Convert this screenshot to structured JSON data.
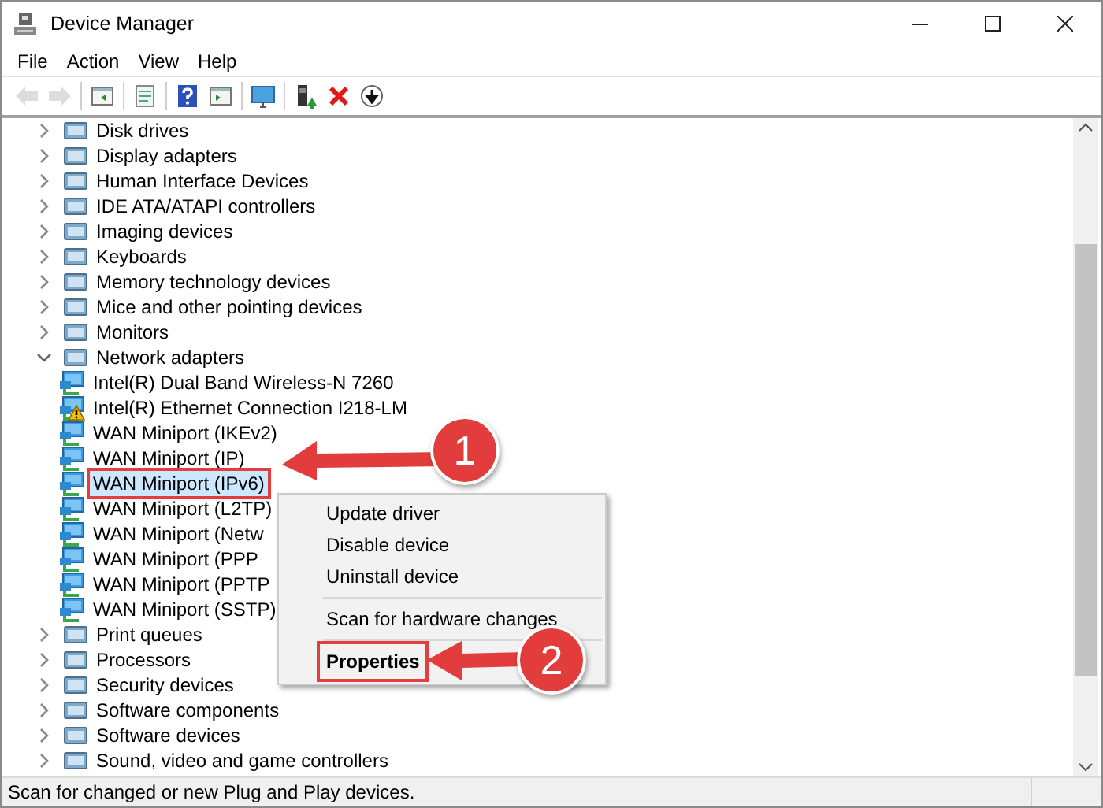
{
  "window": {
    "title": "Device Manager"
  },
  "menu_bar": [
    "File",
    "Action",
    "View",
    "Help"
  ],
  "toolbar": [
    [
      {
        "kind": "back",
        "disabled": true
      },
      {
        "kind": "forward",
        "disabled": true
      }
    ],
    [
      {
        "kind": "console-tree",
        "disabled": false
      }
    ],
    [
      {
        "kind": "properties",
        "disabled": false
      }
    ],
    [
      {
        "kind": "help",
        "disabled": false
      },
      {
        "kind": "action-pane",
        "disabled": false
      }
    ],
    [
      {
        "kind": "scan",
        "disabled": false
      }
    ],
    [
      {
        "kind": "update",
        "disabled": false
      },
      {
        "kind": "uninstall",
        "disabled": false
      },
      {
        "kind": "disable",
        "disabled": false
      }
    ]
  ],
  "tree": [
    {
      "label": "Disk drives",
      "expanded": false
    },
    {
      "label": "Display adapters",
      "expanded": false
    },
    {
      "label": "Human Interface Devices",
      "expanded": false
    },
    {
      "label": "IDE ATA/ATAPI controllers",
      "expanded": false
    },
    {
      "label": "Imaging devices",
      "expanded": false
    },
    {
      "label": "Keyboards",
      "expanded": false
    },
    {
      "label": "Memory technology devices",
      "expanded": false
    },
    {
      "label": "Mice and other pointing devices",
      "expanded": false
    },
    {
      "label": "Monitors",
      "expanded": false
    },
    {
      "label": "Network adapters",
      "expanded": true,
      "children": [
        {
          "label": "Intel(R) Dual Band Wireless-N 7260",
          "selected": false,
          "warning": false,
          "outlined": false
        },
        {
          "label": "Intel(R) Ethernet Connection I218-LM",
          "selected": false,
          "warning": true,
          "outlined": false
        },
        {
          "label": "WAN Miniport (IKEv2)",
          "selected": false,
          "warning": false,
          "outlined": false
        },
        {
          "label": "WAN Miniport (IP)",
          "selected": false,
          "warning": false,
          "outlined": false
        },
        {
          "label": "WAN Miniport (IPv6)",
          "selected": true,
          "warning": false,
          "outlined": true
        },
        {
          "label": "WAN Miniport (L2TP)",
          "selected": false,
          "warning": false,
          "outlined": false
        },
        {
          "label": "WAN Miniport (Netw",
          "selected": false,
          "warning": false,
          "outlined": false
        },
        {
          "label": "WAN Miniport (PPP",
          "selected": false,
          "warning": false,
          "outlined": false
        },
        {
          "label": "WAN Miniport (PPTP",
          "selected": false,
          "warning": false,
          "outlined": false
        },
        {
          "label": "WAN Miniport (SSTP)",
          "selected": false,
          "warning": false,
          "outlined": false
        }
      ]
    },
    {
      "label": "Print queues",
      "expanded": false
    },
    {
      "label": "Processors",
      "expanded": false
    },
    {
      "label": "Security devices",
      "expanded": false
    },
    {
      "label": "Software components",
      "expanded": false
    },
    {
      "label": "Software devices",
      "expanded": false
    },
    {
      "label": "Sound, video and game controllers",
      "expanded": false
    }
  ],
  "context_menu": [
    {
      "kind": "item",
      "label": "Update driver",
      "default": false,
      "outlined": false
    },
    {
      "kind": "item",
      "label": "Disable device",
      "default": false,
      "outlined": false
    },
    {
      "kind": "item",
      "label": "Uninstall device",
      "default": false,
      "outlined": false
    },
    {
      "kind": "separator"
    },
    {
      "kind": "item",
      "label": "Scan for hardware changes",
      "default": false,
      "outlined": false
    },
    {
      "kind": "separator"
    },
    {
      "kind": "item",
      "label": "Properties",
      "default": true,
      "outlined": true
    }
  ],
  "callouts": [
    {
      "number": "1"
    },
    {
      "number": "2"
    }
  ],
  "status_bar": "Scan for changed or new Plug and Play devices."
}
